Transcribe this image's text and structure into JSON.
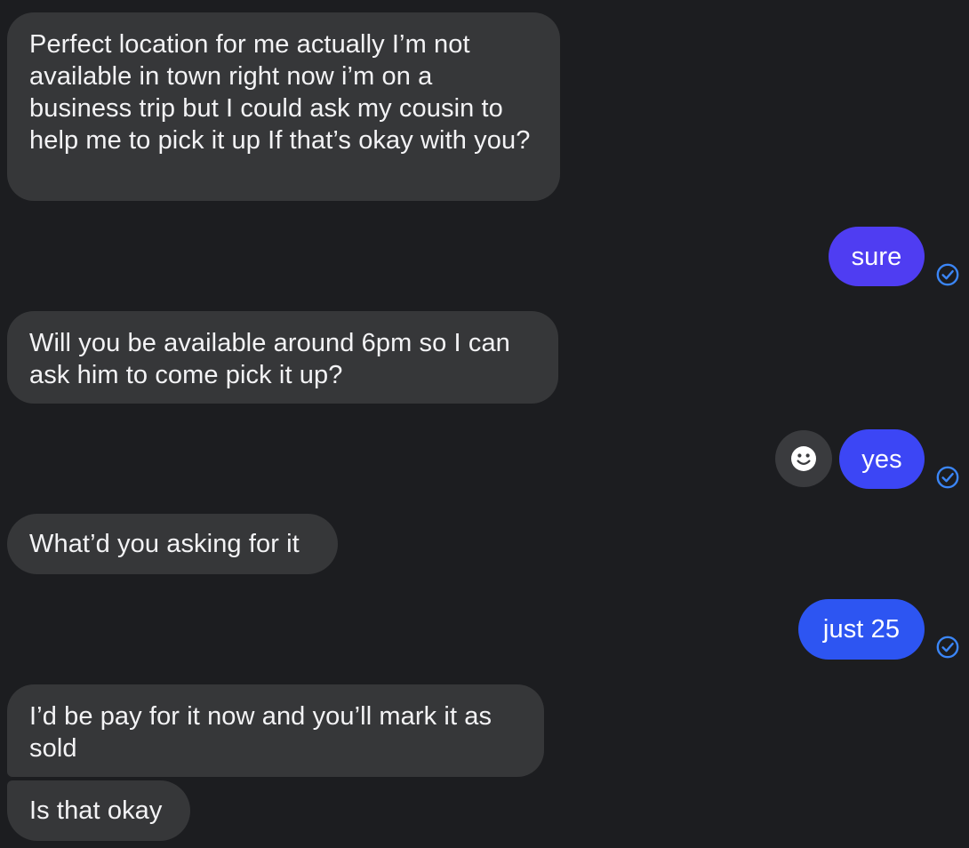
{
  "conversation": {
    "messages": [
      {
        "direction": "incoming",
        "text": "Perfect location for me actually I’m not available in town right now i’m on a business trip but I could ask my cousin to help me to pick it up If that’s okay with you?"
      },
      {
        "direction": "outgoing",
        "text": "sure",
        "color": "#4f3df2",
        "read_icon": "check-circle-icon"
      },
      {
        "direction": "incoming",
        "text": "Will you be available around 6pm so I can ask him to come pick it up?"
      },
      {
        "direction": "outgoing",
        "text": "yes",
        "color": "#3c46f5",
        "read_icon": "check-circle-icon",
        "reaction_button_icon": "smiley-face-icon"
      },
      {
        "direction": "incoming",
        "text": "What’d you asking for it"
      },
      {
        "direction": "outgoing",
        "text": "just 25",
        "color": "#2d55f2",
        "read_icon": "check-circle-icon"
      },
      {
        "direction": "incoming",
        "text": "I’d be pay for it now and you’ll mark it as sold"
      },
      {
        "direction": "incoming",
        "text": "Is that okay"
      }
    ]
  },
  "theme": {
    "background": "#1c1d20",
    "incoming_bubble": "#363739",
    "read_receipt": "#3b86f7"
  }
}
